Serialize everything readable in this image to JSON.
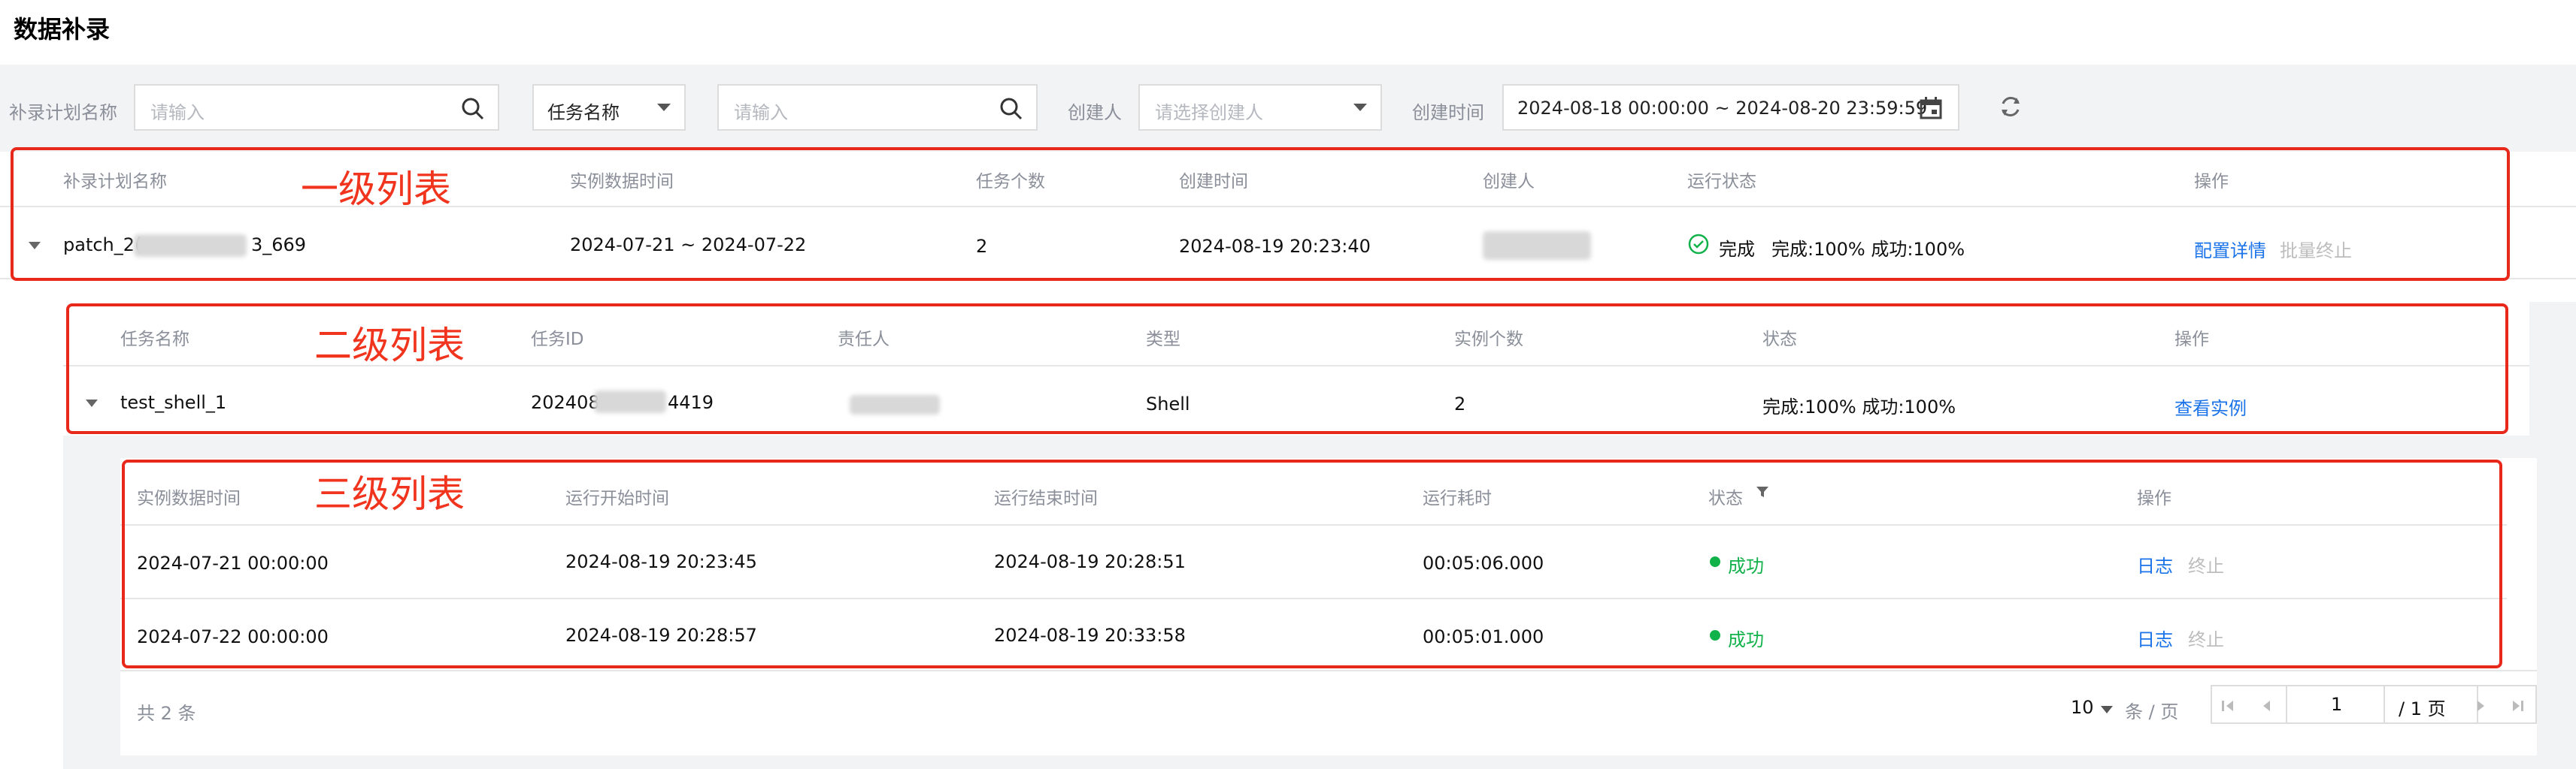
{
  "page_title": "数据补录",
  "filters": {
    "plan_name_label": "补录计划名称",
    "plan_name_placeholder": "请输入",
    "task_type_select": "任务名称",
    "task_input_placeholder": "请输入",
    "creator_label": "创建人",
    "creator_placeholder": "请选择创建人",
    "created_time_label": "创建时间",
    "date_range": "2024-08-18 00:00:00  ~ 2024-08-20 23:59:59"
  },
  "annotations": {
    "level1": "一级列表",
    "level2": "二级列表",
    "level3": "三级列表"
  },
  "level1": {
    "headers": [
      "补录计划名称",
      "实例数据时间",
      "任务个数",
      "创建时间",
      "创建人",
      "运行状态",
      "操作"
    ],
    "row": {
      "name_prefix": "patch_2(",
      "name_suffix": "3_669",
      "data_time": "2024-07-21 ~ 2024-07-22",
      "task_count": "2",
      "created_time": "2024-08-19 20:23:40",
      "status": "完成",
      "progress": "完成:100%  成功:100%",
      "action_detail": "配置详情",
      "action_stop": "批量终止"
    }
  },
  "level2": {
    "headers": [
      "任务名称",
      "任务ID",
      "责任人",
      "类型",
      "实例个数",
      "状态",
      "操作"
    ],
    "row": {
      "task_name": "test_shell_1",
      "task_id_prefix": "202408",
      "task_id_suffix": "4419",
      "type": "Shell",
      "instance_count": "2",
      "status": "完成:100%   成功:100%",
      "action": "查看实例"
    }
  },
  "level3": {
    "headers": [
      "实例数据时间",
      "运行开始时间",
      "运行结束时间",
      "运行耗时",
      "状态",
      "操作"
    ],
    "rows": [
      {
        "data_time": "2024-07-21 00:00:00",
        "start": "2024-08-19 20:23:45",
        "end": "2024-08-19 20:28:51",
        "duration": "00:05:06.000",
        "status": "成功",
        "log": "日志",
        "stop": "终止"
      },
      {
        "data_time": "2024-07-22 00:00:00",
        "start": "2024-08-19 20:28:57",
        "end": "2024-08-19 20:33:58",
        "duration": "00:05:01.000",
        "status": "成功",
        "log": "日志",
        "stop": "终止"
      }
    ]
  },
  "pagination": {
    "total": "共  2  条",
    "page_size": "10",
    "per_page_label": "条 / 页",
    "current_page": "1",
    "total_pages": "/ 1 页"
  },
  "colors": {
    "accent": "#1a73e8",
    "success": "#12b24a",
    "annotation": "#e8281b"
  }
}
